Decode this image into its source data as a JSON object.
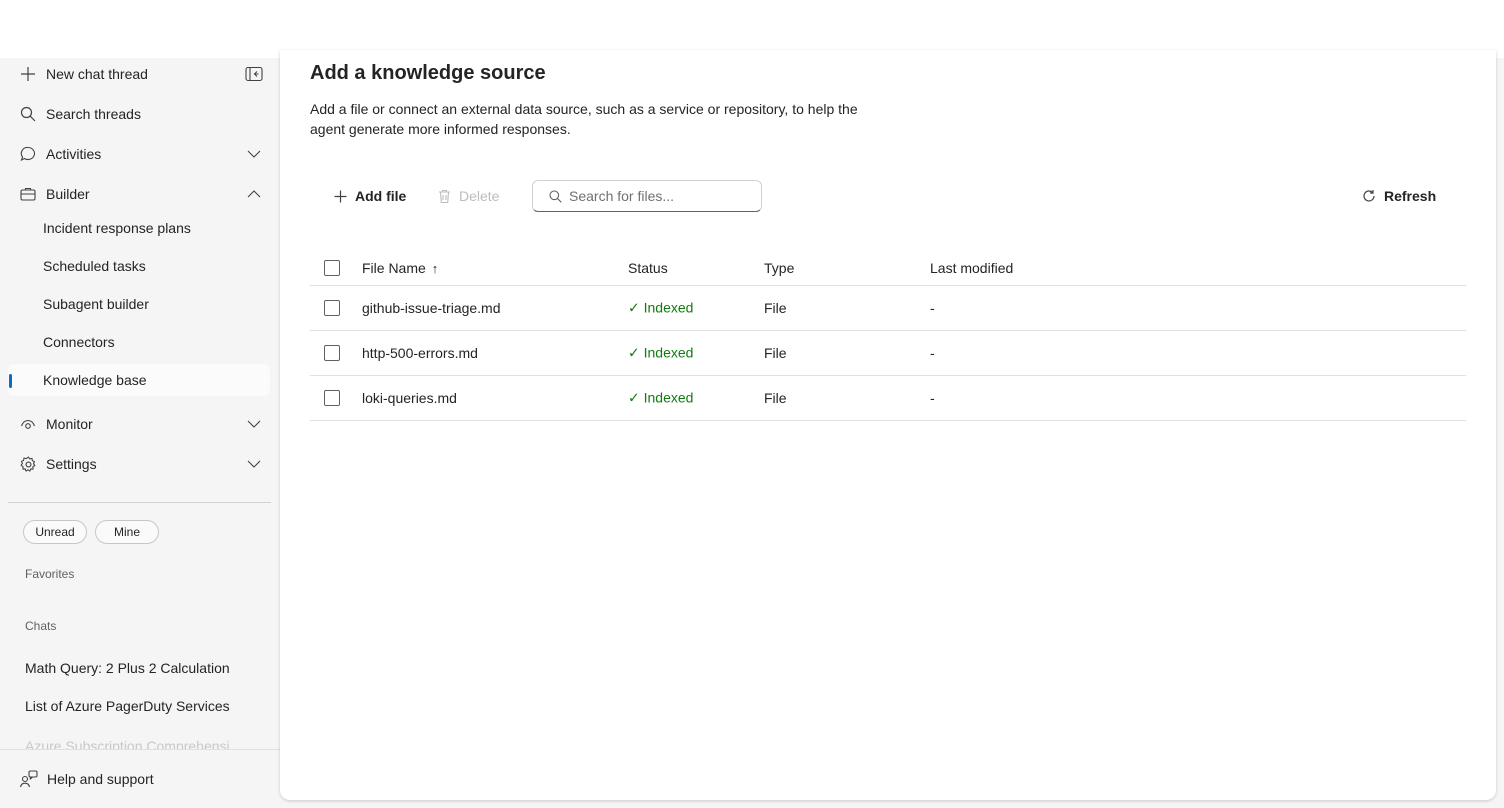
{
  "sidebar": {
    "new_chat": "New chat thread",
    "search": "Search threads",
    "activities": "Activities",
    "builder": "Builder",
    "builder_items": [
      "Incident response plans",
      "Scheduled tasks",
      "Subagent builder",
      "Connectors",
      "Knowledge base"
    ],
    "monitor": "Monitor",
    "settings": "Settings",
    "filters": [
      "Unread",
      "Mine"
    ],
    "favorites_label": "Favorites",
    "chats_label": "Chats",
    "chats": [
      "Math Query: 2 Plus 2 Calculation",
      "List of Azure PagerDuty Services",
      "Azure Subscription Comprehensi"
    ],
    "help": "Help and support"
  },
  "main": {
    "title": "Add a knowledge source",
    "description": "Add a file or connect an external data source, such as a service or repository, to help the agent generate more informed responses.",
    "toolbar": {
      "add_file": "Add file",
      "delete": "Delete",
      "search_placeholder": "Search for files...",
      "refresh": "Refresh"
    },
    "table": {
      "columns": [
        "File Name",
        "Status",
        "Type",
        "Last modified"
      ],
      "sort_indicator": "↑",
      "rows": [
        {
          "name": "github-issue-triage.md",
          "status": "✓ Indexed",
          "type": "File",
          "modified": "-"
        },
        {
          "name": "http-500-errors.md",
          "status": "✓ Indexed",
          "type": "File",
          "modified": "-"
        },
        {
          "name": "loki-queries.md",
          "status": "✓ Indexed",
          "type": "File",
          "modified": "-"
        }
      ]
    }
  },
  "colors": {
    "accent": "#0f6cbd",
    "status_ok": "#107c10",
    "sidebar_bg": "#f5f5f5"
  }
}
